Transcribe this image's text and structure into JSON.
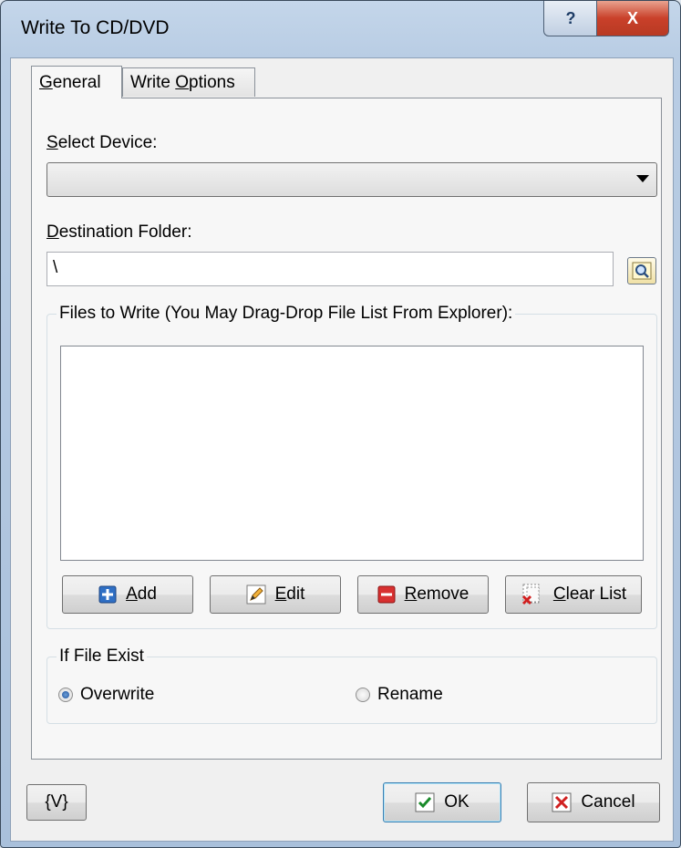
{
  "window": {
    "title": "Write To CD/DVD",
    "help_glyph": "?",
    "close_glyph": "X"
  },
  "tabs": [
    {
      "label_u": "G",
      "label_rest": "eneral"
    },
    {
      "label_pre": "Write ",
      "label_u": "O",
      "label_rest": "ptions"
    }
  ],
  "device": {
    "label_u": "S",
    "label_rest": "elect Device:",
    "value": ""
  },
  "destination": {
    "label_u": "D",
    "label_rest": "estination Folder:",
    "value": "\\"
  },
  "files_group": {
    "title": "Files to Write (You May Drag-Drop File List From Explorer):",
    "items": [],
    "buttons": {
      "add": {
        "u": "A",
        "rest": "dd"
      },
      "edit": {
        "u": "E",
        "rest": "dit"
      },
      "remove": {
        "u": "R",
        "rest": "emove"
      },
      "clear": {
        "u": "C",
        "rest": "lear List"
      }
    }
  },
  "if_exist_group": {
    "title": "If File Exist",
    "options": [
      {
        "label": "Overwrite",
        "checked": true
      },
      {
        "label": "Rename",
        "checked": false
      }
    ]
  },
  "footer": {
    "variables": "{V}",
    "ok": "OK",
    "cancel": "Cancel"
  }
}
